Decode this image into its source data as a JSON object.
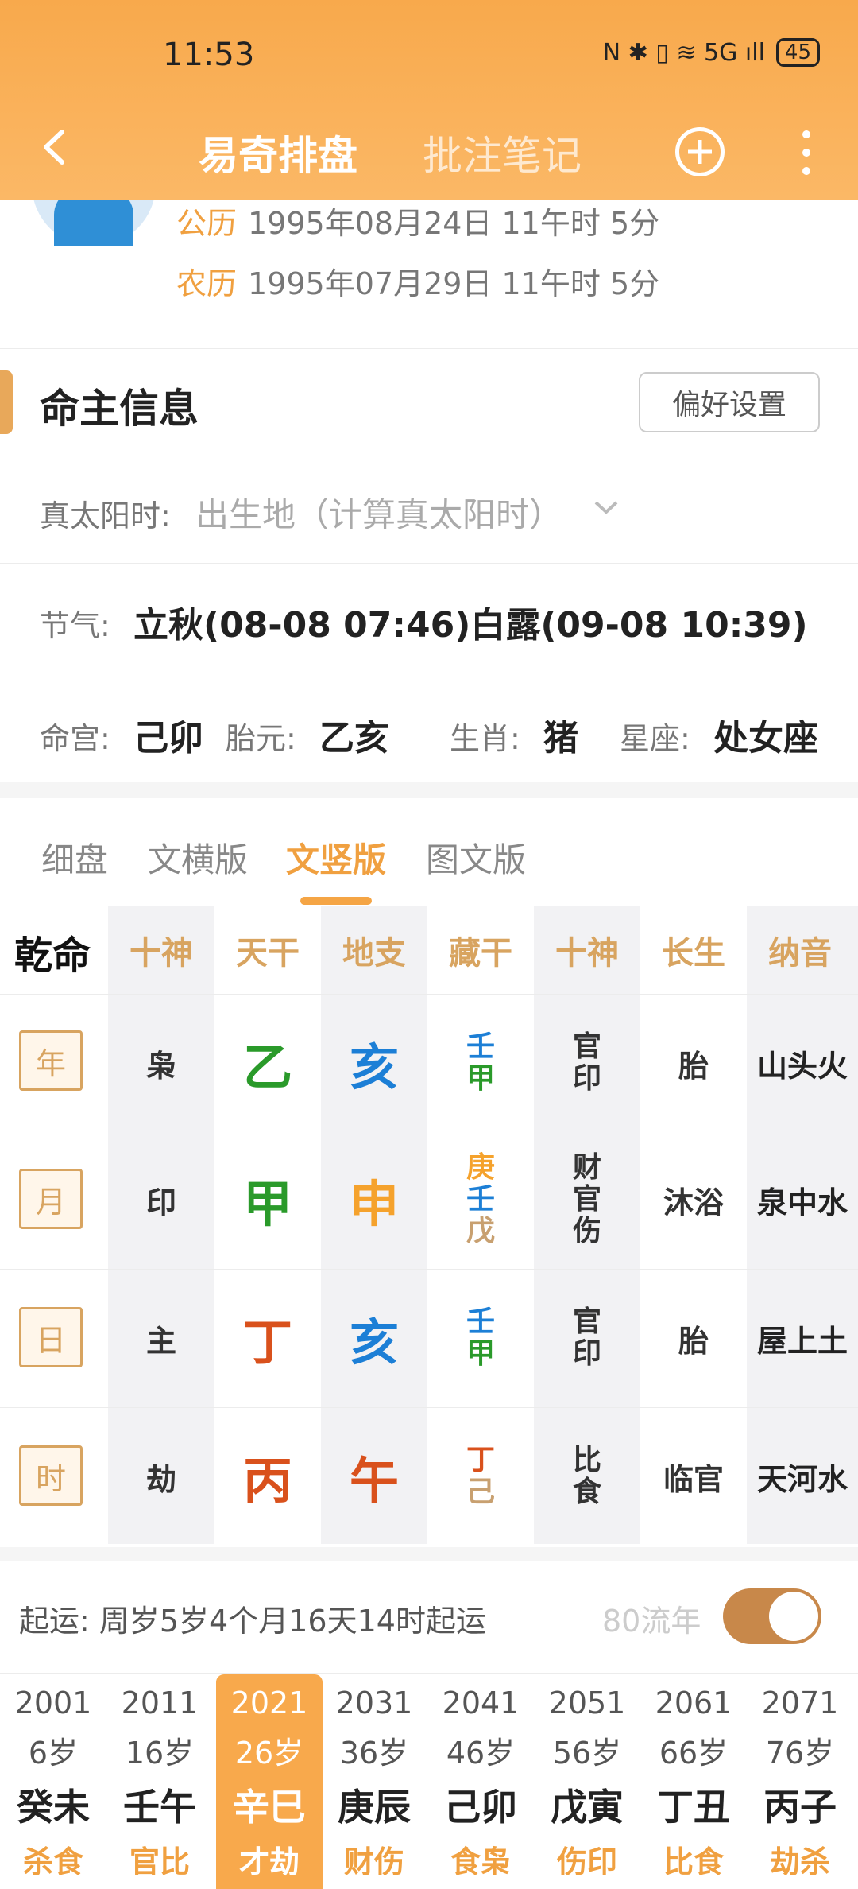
{
  "status": {
    "time": "11:53",
    "icons": "N ✱ ▯ ≋ 5G ıll",
    "battery": "45"
  },
  "nav": {
    "tab_active": "易奇排盘",
    "tab_other": "批注笔记"
  },
  "dates": {
    "solar_label": "公历",
    "solar": "1995年08月24日 11午时 5分",
    "lunar_label": "农历",
    "lunar": "1995年07月29日 11午时 5分"
  },
  "info": {
    "title": "命主信息",
    "pref": "偏好设置",
    "tst_label": "真太阳时:",
    "tst_ph": "出生地（计算真太阳时）",
    "jq_label": "节气:",
    "jq": "立秋(08-08 07:46)白露(09-08 10:39)",
    "mg_label": "命宫:",
    "mg": "己卯",
    "ty_label": "胎元:",
    "ty": "乙亥",
    "sx_label": "生肖:",
    "sx": "猪",
    "xz_label": "星座:",
    "xz": "处女座"
  },
  "tabs": [
    "细盘",
    "文横版",
    "文竖版",
    "图文版"
  ],
  "table": {
    "corner": "乾命",
    "headers": [
      "十神",
      "天干",
      "地支",
      "藏干",
      "十神",
      "长生",
      "纳音"
    ],
    "rows": [
      {
        "label": "年",
        "ss": "枭",
        "tg": "乙",
        "dz": "亥",
        "cg": [
          "壬",
          "甲"
        ],
        "ss2": [
          "官",
          "印"
        ],
        "cs": "胎",
        "ny": "山头火"
      },
      {
        "label": "月",
        "ss": "印",
        "tg": "甲",
        "dz": "申",
        "cg": [
          "庚",
          "壬",
          "戊"
        ],
        "ss2": [
          "财",
          "官",
          "伤"
        ],
        "cs": "沐浴",
        "ny": "泉中水"
      },
      {
        "label": "日",
        "ss": "主",
        "tg": "丁",
        "dz": "亥",
        "cg": [
          "壬",
          "甲"
        ],
        "ss2": [
          "官",
          "印"
        ],
        "cs": "胎",
        "ny": "屋上土"
      },
      {
        "label": "时",
        "ss": "劫",
        "tg": "丙",
        "dz": "午",
        "cg": [
          "丁",
          "己"
        ],
        "ss2": [
          "比",
          "食"
        ],
        "cs": "临官",
        "ny": "天河水"
      }
    ]
  },
  "qiyun": {
    "text": "起运:  周岁5岁4个月16天14时起运",
    "liu": "80流年"
  },
  "dayun": [
    {
      "year": "2001",
      "age": "6岁",
      "gz": "癸未",
      "ss": "杀食"
    },
    {
      "year": "2011",
      "age": "16岁",
      "gz": "壬午",
      "ss": "官比"
    },
    {
      "year": "2021",
      "age": "26岁",
      "gz": "辛巳",
      "ss": "才劫"
    },
    {
      "year": "2031",
      "age": "36岁",
      "gz": "庚辰",
      "ss": "财伤"
    },
    {
      "year": "2041",
      "age": "46岁",
      "gz": "己卯",
      "ss": "食枭"
    },
    {
      "year": "2051",
      "age": "56岁",
      "gz": "戊寅",
      "ss": "伤印"
    },
    {
      "year": "2061",
      "age": "66岁",
      "gz": "丁丑",
      "ss": "比食"
    },
    {
      "year": "2071",
      "age": "76岁",
      "gz": "丙子",
      "ss": "劫杀"
    }
  ]
}
